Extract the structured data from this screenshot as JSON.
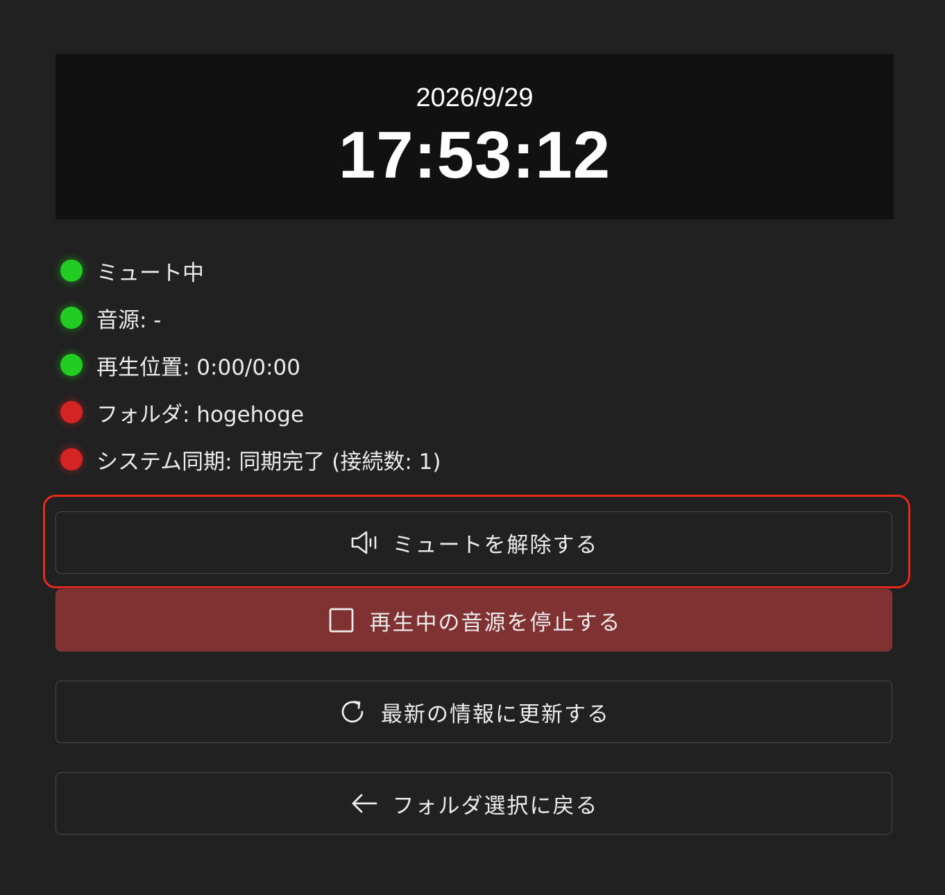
{
  "clock": {
    "date": "2026/9/29",
    "time": "17:53:12"
  },
  "status": [
    {
      "label": "ミュート中",
      "state": "green"
    },
    {
      "label": "音源: -",
      "state": "green"
    },
    {
      "label": "再生位置: 0:00/0:00",
      "state": "green"
    },
    {
      "label": "フォルダ: hogehoge",
      "state": "red"
    },
    {
      "label": "システム同期: 同期完了 (接続数: 1)",
      "state": "red"
    }
  ],
  "buttons": {
    "unmute": {
      "label": "ミュートを解除する",
      "icon": "speaker-icon"
    },
    "stop": {
      "label": "再生中の音源を停止する",
      "icon": "stop-square-icon"
    },
    "refresh": {
      "label": "最新の情報に更新する",
      "icon": "refresh-icon"
    },
    "back": {
      "label": "フォルダ選択に戻る",
      "icon": "arrow-left-icon"
    }
  },
  "colors": {
    "background": "#212121",
    "clock_background": "#111111",
    "status_green": "#22cc22",
    "status_red": "#d42424",
    "danger_button": "#803132",
    "highlight": "#e8281b"
  }
}
